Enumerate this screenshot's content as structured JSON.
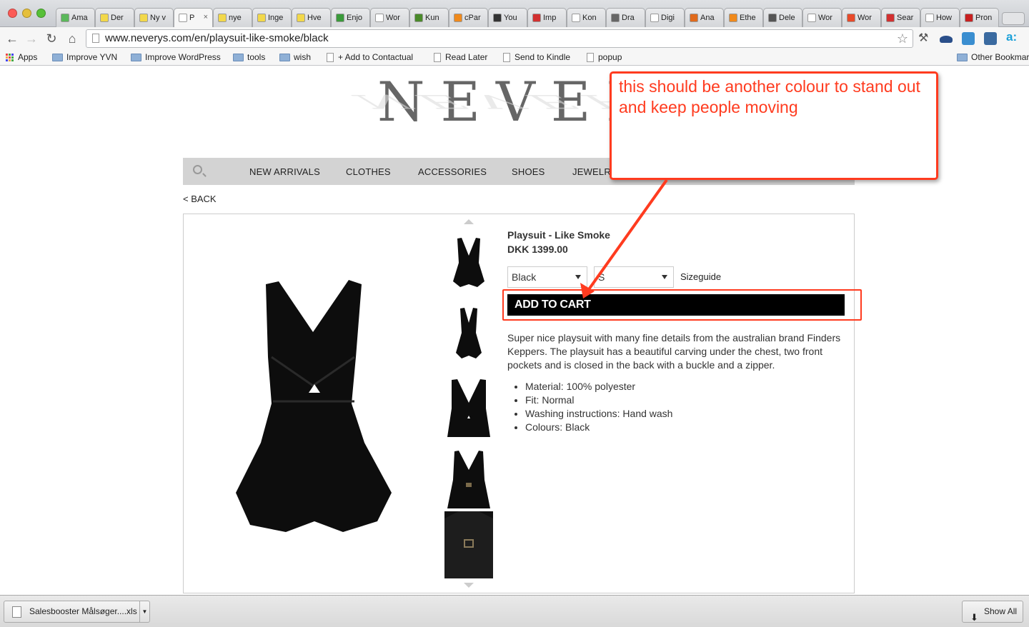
{
  "browser": {
    "tabs": [
      {
        "label": "Ama",
        "fav": "#5bb85b"
      },
      {
        "label": "Der",
        "fav": "#f2d84a"
      },
      {
        "label": "Ny v",
        "fav": "#f2d84a"
      },
      {
        "label": "P",
        "fav": "#ffffff",
        "active": true
      },
      {
        "label": "nye",
        "fav": "#f2d84a"
      },
      {
        "label": "Inge",
        "fav": "#f2d84a"
      },
      {
        "label": "Hve",
        "fav": "#f2d84a"
      },
      {
        "label": "Enjo",
        "fav": "#3a9a3a"
      },
      {
        "label": "Wor",
        "fav": "#ffffff"
      },
      {
        "label": "Kun",
        "fav": "#4a8a2a"
      },
      {
        "label": "cPar",
        "fav": "#f08a1c"
      },
      {
        "label": "You",
        "fav": "#333333"
      },
      {
        "label": "Imp",
        "fav": "#d23030"
      },
      {
        "label": "Kon",
        "fav": "#ffffff"
      },
      {
        "label": "Dra",
        "fav": "#666666"
      },
      {
        "label": "Digi",
        "fav": "#ffffff"
      },
      {
        "label": "Ana",
        "fav": "#e06a1c"
      },
      {
        "label": "Ethe",
        "fav": "#f08a1c"
      },
      {
        "label": "Dele",
        "fav": "#555555"
      },
      {
        "label": "Wor",
        "fav": "#ffffff"
      },
      {
        "label": "Wor",
        "fav": "#e84a2a"
      },
      {
        "label": "Sear",
        "fav": "#d23030"
      },
      {
        "label": "How",
        "fav": "#ffffff"
      },
      {
        "label": "Pron",
        "fav": "#c82020"
      }
    ],
    "url": "www.neverys.com/en/playsuit-like-smoke/black",
    "bookmarks": {
      "apps": "Apps",
      "items": [
        "Improve YVN",
        "Improve WordPress",
        "tools",
        "wish",
        "+ Add to Contactual",
        "Read Later",
        "Send to Kindle",
        "popup"
      ],
      "other": "Other Bookmarks"
    }
  },
  "site": {
    "logo": "NEVERYS",
    "nav": [
      "NEW ARRIVALS",
      "CLOTHES",
      "ACCESSORIES",
      "SHOES",
      "JEWELRY"
    ],
    "back": "< BACK"
  },
  "product": {
    "title": "Playsuit - Like Smoke",
    "price": "DKK 1399.00",
    "color_select": "Black",
    "size_select": "S",
    "sizeguide": "Sizeguide",
    "add_to_cart": "ADD TO CART",
    "description": "Super nice playsuit with many fine details from the australian brand Finders Keppers. The playsuit has a beautiful carving under the chest, two front pockets and is closed in the back with a buckle and a zipper.",
    "specs": [
      "Material: 100% polyester",
      "Fit: Normal",
      "Washing instructions: Hand wash",
      "Colours: Black"
    ]
  },
  "annotation": {
    "text": "this should be another colour to stand out and keep people moving",
    "color": "#ff3b1f"
  },
  "downloads": {
    "file": "Salesbooster Målsøger....xls",
    "show_all": "Show All"
  }
}
